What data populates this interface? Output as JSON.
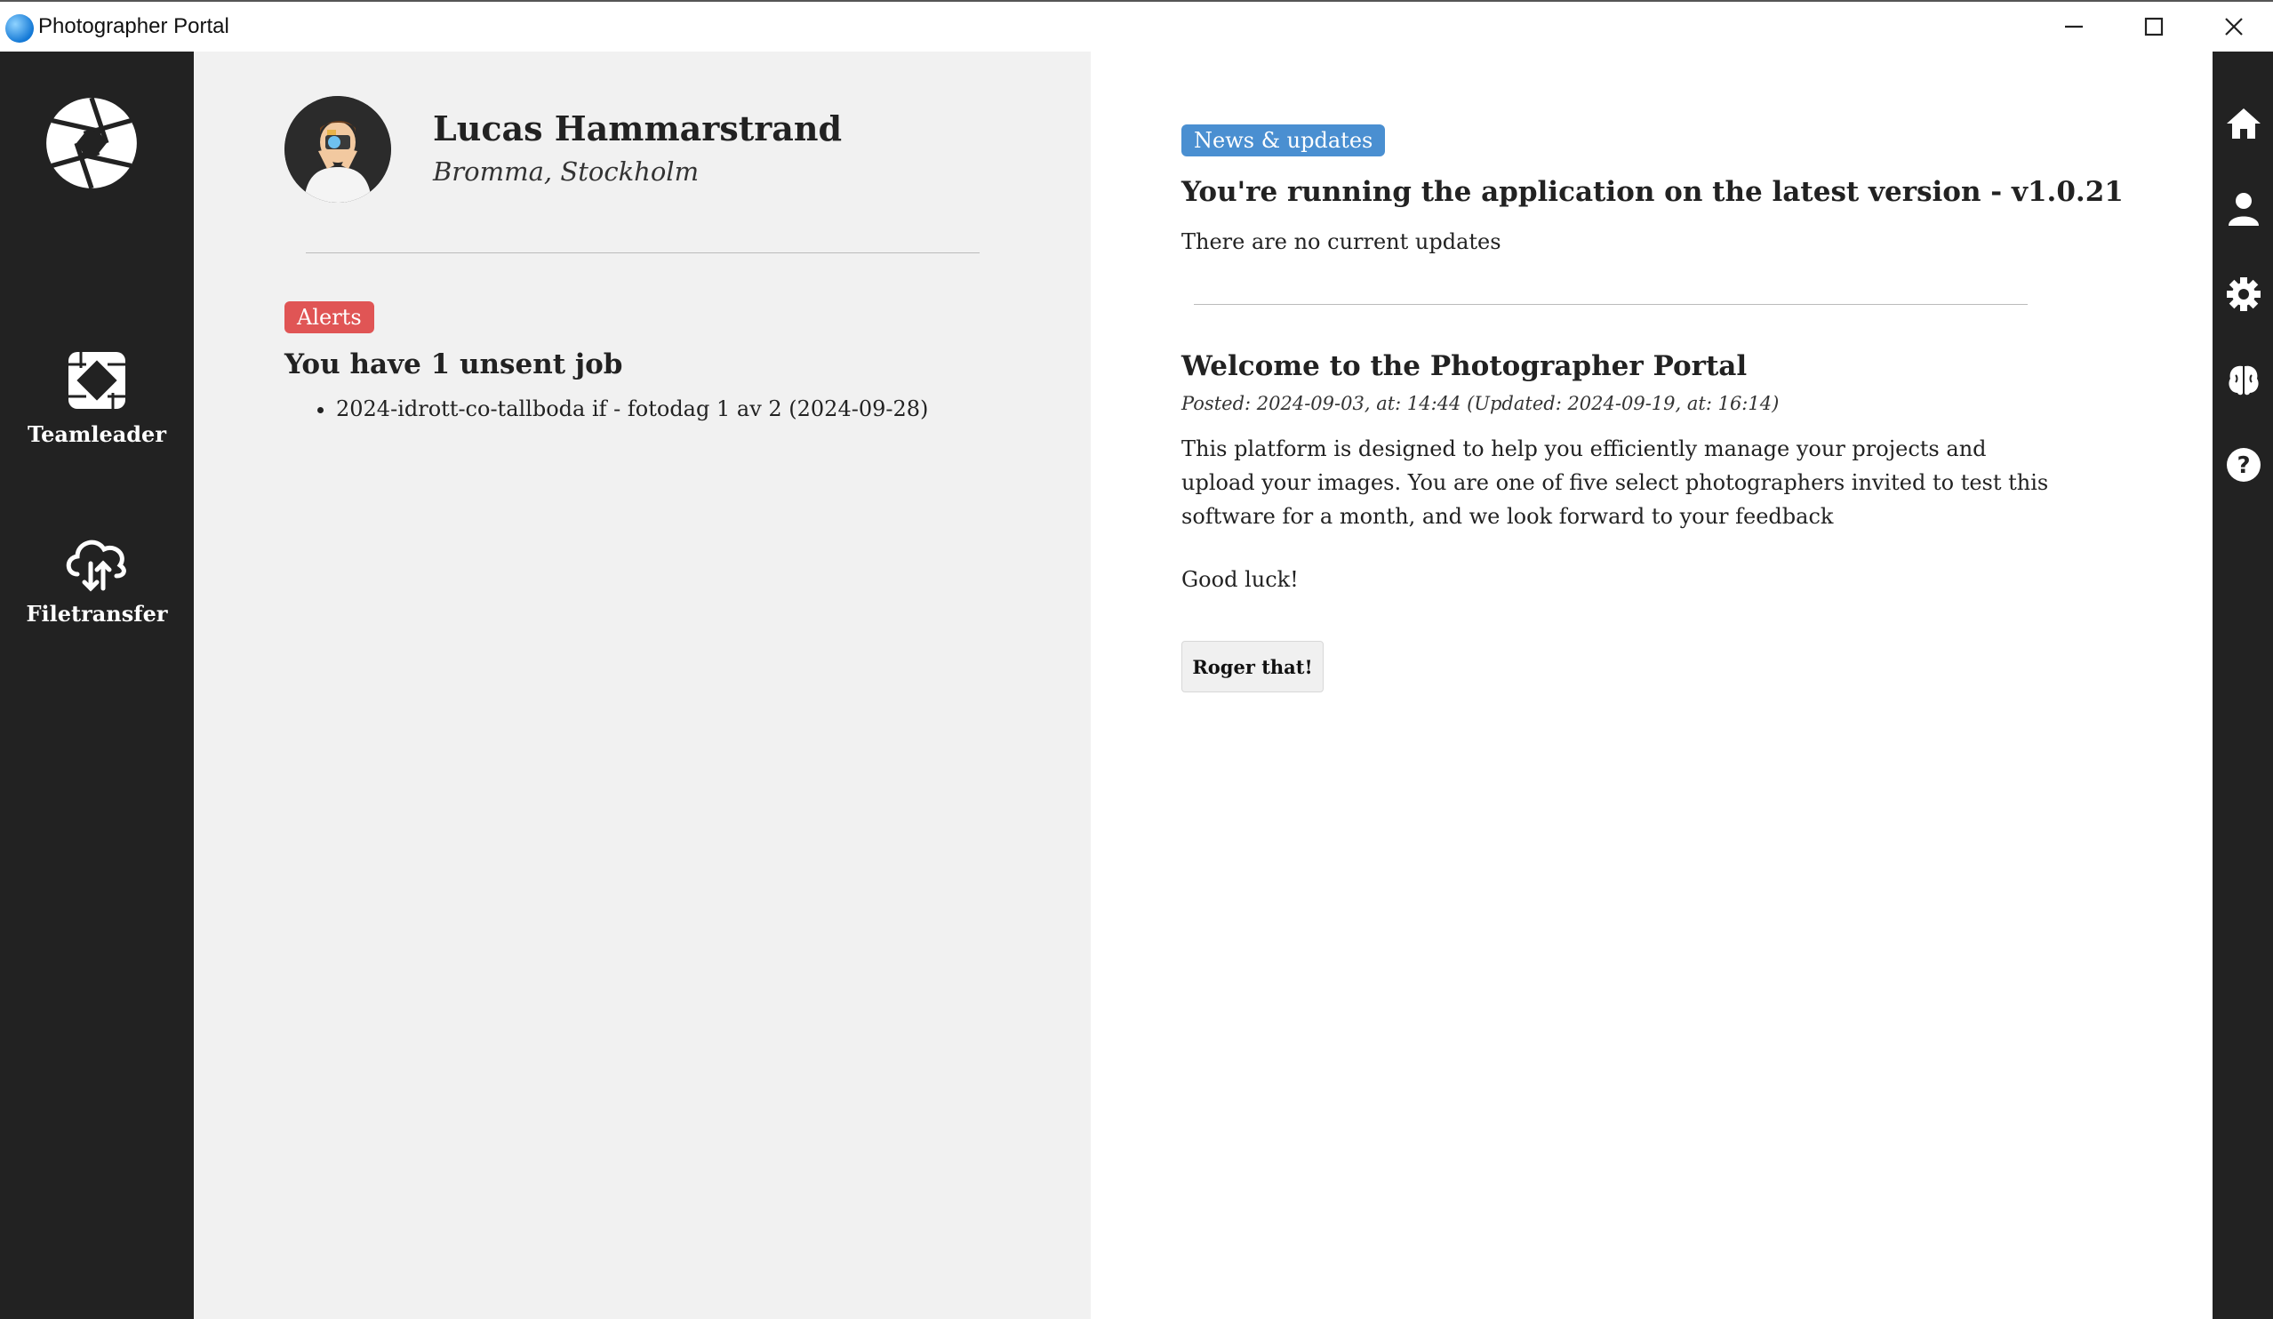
{
  "window": {
    "title": "Photographer Portal",
    "controls": [
      "minimize",
      "maximize",
      "close"
    ]
  },
  "left_sidebar": {
    "logo_icon": "camera-aperture-icon",
    "items": [
      {
        "label": "Teamleader",
        "icon": "team-hands-icon"
      },
      {
        "label": "Filetransfer",
        "icon": "cloud-transfer-icon"
      }
    ]
  },
  "profile": {
    "name": "Lucas Hammarstrand",
    "location": "Bromma, Stockholm",
    "avatar_icon": "photographer-avatar"
  },
  "alerts": {
    "badge": "Alerts",
    "heading": "You have 1 unsent job",
    "items": [
      "2024-idrott-co-tallboda if - fotodag 1 av 2 (2024-09-28)"
    ]
  },
  "news": {
    "badge": "News & updates",
    "version_heading": "You're running the application on the latest version - v1.0.21",
    "status_text": "There are no current updates",
    "post": {
      "title": "Welcome to the Photographer Portal",
      "meta": "Posted: 2024-09-03, at: 14:44  (Updated: 2024-09-19, at: 16:14)",
      "body": "This platform is designed to help you efficiently manage your projects and upload your images. You are one of five select photographers invited to test this software for a month, and we look forward to your feedback",
      "closing": "Good luck!",
      "button_label": "Roger that!"
    }
  },
  "right_sidebar": {
    "icons": [
      "home-icon",
      "user-icon",
      "settings-icon",
      "brain-icon",
      "help-icon"
    ]
  },
  "colors": {
    "sidebar": "#222222",
    "alerts_badge": "#e05555",
    "news_badge": "#4a8fd1",
    "panel_bg": "#f1f1f1",
    "content_bg": "#ffffff"
  }
}
